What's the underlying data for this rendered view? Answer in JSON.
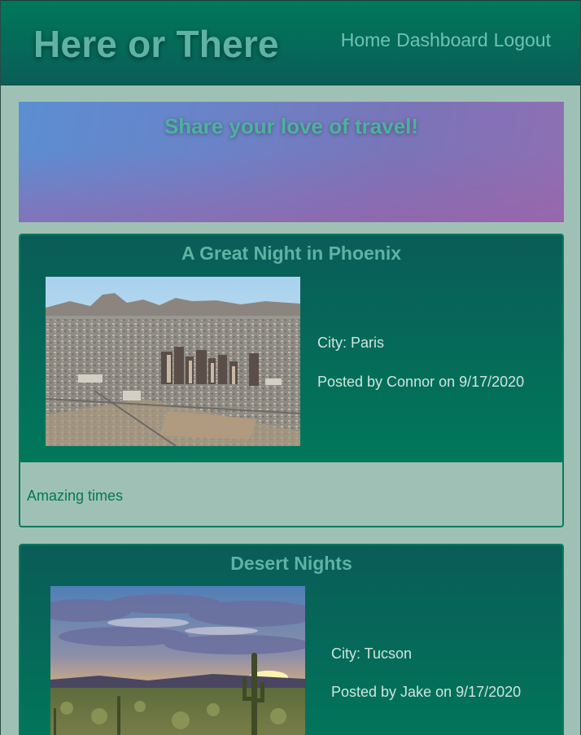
{
  "header": {
    "title": "Here or There",
    "nav": [
      "Home",
      "Dashboard",
      "Logout"
    ]
  },
  "hero": {
    "title": "Share your love of travel!"
  },
  "posts": [
    {
      "title": "A Great Night in Phoenix",
      "city": "City: Paris",
      "posted": "Posted by Connor on 9/17/2020",
      "text": "Amazing times",
      "image": "phoenix-city-aerial-photo"
    },
    {
      "title": "Desert Nights",
      "city": "City: Tucson",
      "posted": "Posted by Jake on 9/17/2020",
      "text": "",
      "image": "desert-sunset-saguaro-photo"
    }
  ],
  "colors": {
    "header": "#0a6b58",
    "page_background": "#9fc1b5",
    "card_text": "#00794f",
    "title_teal": "#5fb3a4"
  }
}
